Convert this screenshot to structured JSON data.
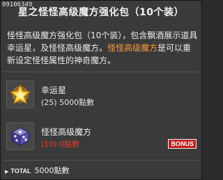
{
  "item_id": "09106349",
  "title": "星之怪怪高级魔方强化包（10个装）",
  "description": {
    "part1": "怪怪高级魔方强化包（10个装），包含飘酒展示道具幸运星，及怪怪高级魔方。",
    "highlight": "怪怪高级魔方",
    "part2": "是可以重新设定怪怪属性的神奇魔方。"
  },
  "items": [
    {
      "name": "幸运星",
      "price": "(25) 5000點數",
      "icon": "golden-star-icon"
    },
    {
      "name": "怪怪高级魔方",
      "price": "(10) 0點數",
      "icon": "purple-cube-icon",
      "badge": "BONUS"
    }
  ],
  "total": {
    "label": "TOTAL",
    "value": "5000點數"
  },
  "colors": {
    "highlight": "#ff9a30",
    "bonus_price": "#e63c2c",
    "badge": "#c41d1d"
  }
}
